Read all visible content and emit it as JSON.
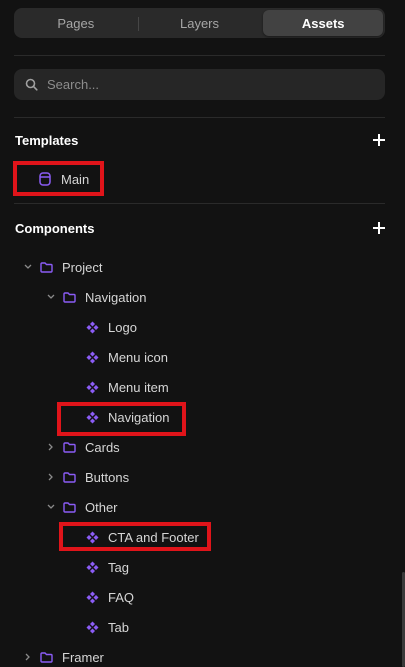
{
  "tabs": [
    {
      "label": "Pages",
      "active": false
    },
    {
      "label": "Layers",
      "active": false
    },
    {
      "label": "Assets",
      "active": true
    }
  ],
  "search": {
    "placeholder": "Search..."
  },
  "templates": {
    "title": "Templates",
    "items": [
      {
        "label": "Main",
        "icon": "page-icon"
      }
    ]
  },
  "components": {
    "title": "Components",
    "tree": [
      {
        "label": "Project",
        "type": "folder",
        "expanded": true
      },
      {
        "label": "Navigation",
        "type": "folder",
        "expanded": true
      },
      {
        "label": "Logo",
        "type": "component"
      },
      {
        "label": "Menu icon",
        "type": "component"
      },
      {
        "label": "Menu item",
        "type": "component"
      },
      {
        "label": "Navigation",
        "type": "component"
      },
      {
        "label": "Cards",
        "type": "folder",
        "expanded": false
      },
      {
        "label": "Buttons",
        "type": "folder",
        "expanded": false
      },
      {
        "label": "Other",
        "type": "folder",
        "expanded": true
      },
      {
        "label": "CTA and Footer",
        "type": "component"
      },
      {
        "label": "Tag",
        "type": "component"
      },
      {
        "label": "FAQ",
        "type": "component"
      },
      {
        "label": "Tab",
        "type": "component"
      },
      {
        "label": "Framer",
        "type": "folder",
        "expanded": false
      }
    ]
  },
  "colors": {
    "accent": "#8b5cf6",
    "highlight": "#e0141a",
    "background": "#121212"
  }
}
